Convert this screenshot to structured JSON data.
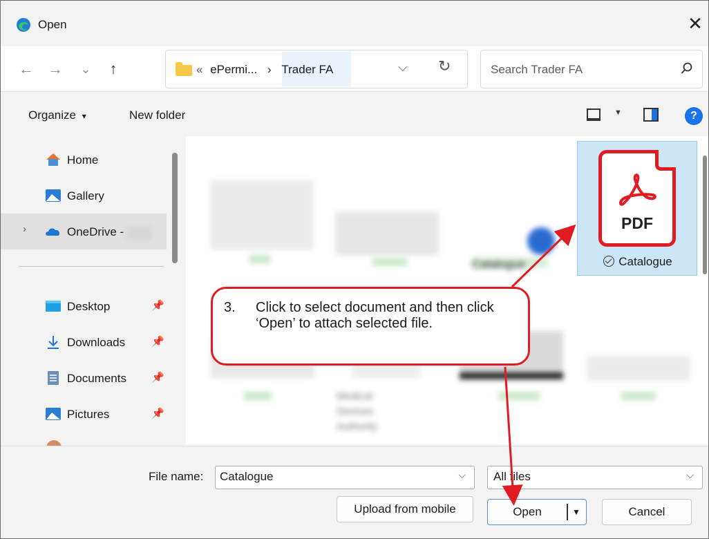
{
  "window": {
    "title": "Open",
    "close": "✕"
  },
  "nav": {
    "back": "←",
    "forward": "→",
    "recent": "⌄",
    "up": "↑",
    "path_prefix": "«",
    "crumb1": "ePermi...",
    "crumb_sep": "›",
    "crumb2": "Trader FA",
    "search_placeholder": "Search Trader FA"
  },
  "commands": {
    "organize": "Organize",
    "organize_caret": "▾",
    "new_folder": "New folder",
    "help": "?"
  },
  "sidebar": {
    "items": [
      {
        "label": "Home"
      },
      {
        "label": "Gallery"
      },
      {
        "label": "OneDrive -"
      },
      {
        "label": "Desktop"
      },
      {
        "label": "Downloads"
      },
      {
        "label": "Documents"
      },
      {
        "label": "Pictures"
      }
    ]
  },
  "files": {
    "selected": {
      "badge": "PDF",
      "name": "Catalogue"
    },
    "blurred_labels": [
      "Catalogue",
      "Medical",
      "Devices",
      "Authority"
    ]
  },
  "bottom": {
    "file_name_label": "File name:",
    "file_name_value": "Catalogue",
    "file_type_value": "All files",
    "upload_button": "Upload from mobile",
    "open_button": "Open",
    "cancel_button": "Cancel"
  },
  "annotation": {
    "number": "3.",
    "text": "Click to select document and then click ‘Open’ to attach selected file.",
    "color": "#e11b22"
  }
}
